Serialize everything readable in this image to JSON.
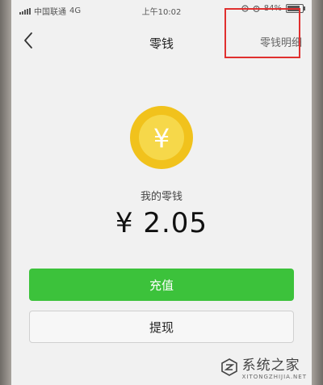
{
  "status_bar": {
    "carrier": "中国联通",
    "network": "4G",
    "time": "上午10:02",
    "battery_level": 84,
    "battery_text": "84%"
  },
  "nav": {
    "title": "零钱",
    "detail_label": "零钱明细",
    "back_icon": "chevron-left-icon",
    "highlight_color": "#e0302f"
  },
  "wallet": {
    "coin_symbol": "¥",
    "coin_icon": "yen-coin-icon",
    "balance_label": "我的零钱",
    "balance_amount": "¥ 2.05"
  },
  "actions": {
    "recharge_label": "充值",
    "withdraw_label": "提现",
    "accent_color": "#3cc23b"
  },
  "watermark": {
    "name": "系统之家",
    "url": "XITONGZHIJIA.NET"
  }
}
